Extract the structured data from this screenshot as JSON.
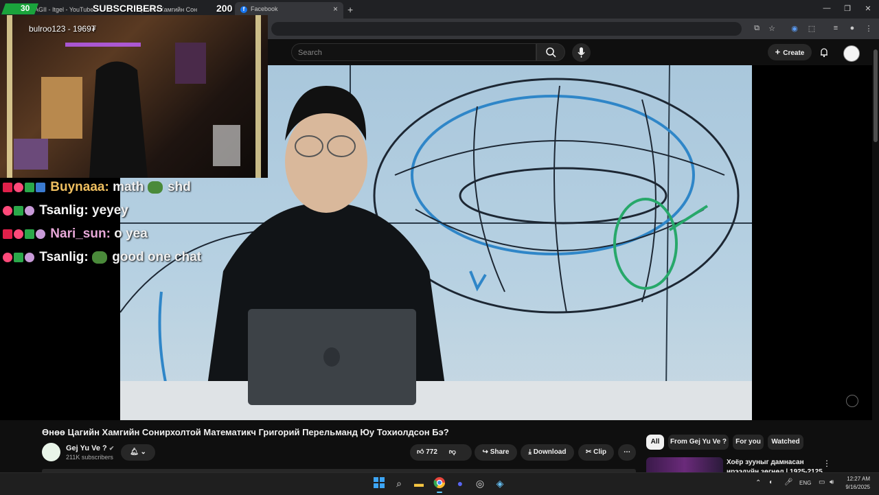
{
  "browser": {
    "tabs": [
      {
        "label": "AGII - Itgel - YouTube"
      },
      {
        "label": "Цагийн Хамгийн Сон"
      },
      {
        "label": "Facebook"
      }
    ],
    "new_tab": "+",
    "close_tab": "×"
  },
  "overlay": {
    "sub_count": "30",
    "sub_label": "SUBSCRIBERS",
    "sub_goal": "200",
    "latest_sub": "bulroo123 - 1969₮",
    "chat": [
      {
        "user": "Buynaaa:",
        "message": "math",
        "tail": "shd",
        "color": "#f0c060"
      },
      {
        "user": "Tsanlig:",
        "message": "yeyey",
        "tail": "",
        "color": "#f8f8f8"
      },
      {
        "user": "Nari_sun:",
        "message": "o yea",
        "tail": "",
        "color": "#e7a8d8"
      },
      {
        "user": "Tsanlig:",
        "message": "good one chat",
        "tail": "",
        "color": "#f8f8f8"
      }
    ]
  },
  "youtube": {
    "search_placeholder": "Search",
    "create_label": "Create",
    "video_title": "Өнөө Цагийн Хамгийн Сонирхолтой Математикч Григорий Перельманд Юу Тохиолдсон Бэ?",
    "channel_name": "Gej Yu Ve ?",
    "subscribers": "211K subscribers",
    "likes": "772",
    "share_label": "Share",
    "download_label": "Download",
    "clip_label": "Clip",
    "chips": [
      "All",
      "From Gej Yu Ve ?",
      "For you",
      "Watched"
    ],
    "rec_title": "Хоёр зууныг дамнасан",
    "rec_title2": "ирээдүйн зөгнөл | 1925-2125"
  },
  "taskbar": {
    "lang": "ENG",
    "time": "12:27 AM",
    "date": "9/16/2025"
  },
  "colors": {
    "accent": "#1aa33c",
    "yt_bg": "#0f0f0f",
    "chip_active": "#f1f1f1"
  }
}
